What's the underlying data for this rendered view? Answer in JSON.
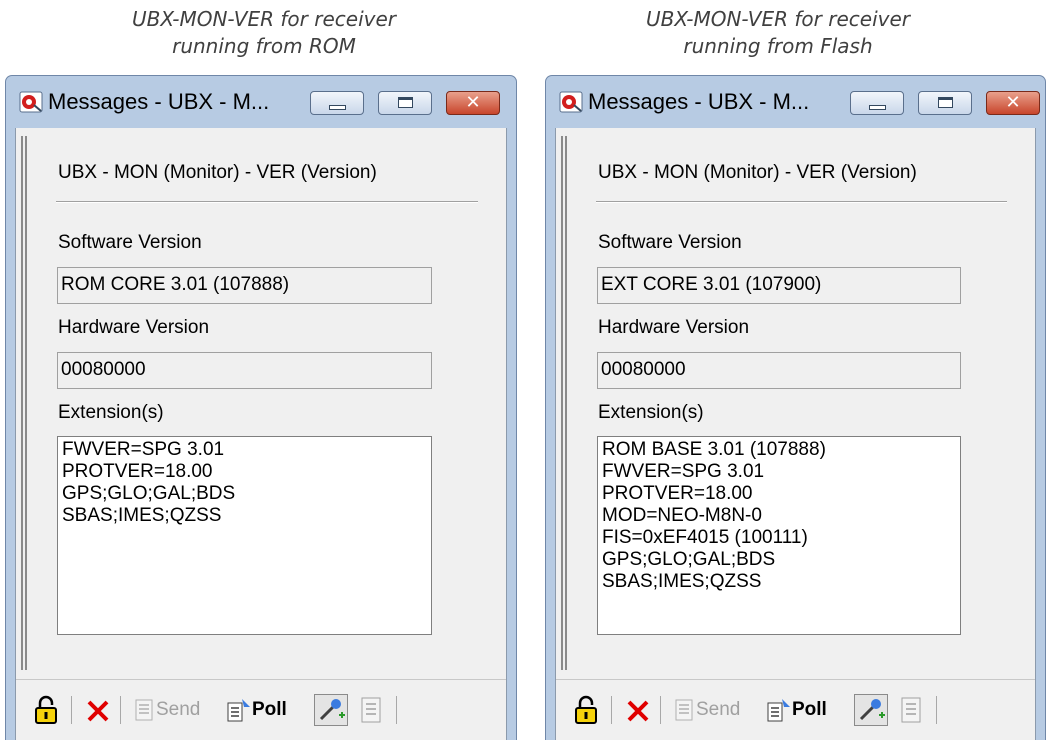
{
  "captions": {
    "left_line1": "UBX-MON-VER for receiver",
    "left_line2": "running from ROM",
    "right_line1": "UBX-MON-VER for receiver",
    "right_line2": "running from Flash"
  },
  "windows": [
    {
      "title": "Messages - UBX - M...",
      "heading": "UBX - MON (Monitor) - VER (Version)",
      "sw_label": "Software Version",
      "sw_value": "ROM CORE 3.01 (107888)",
      "hw_label": "Hardware Version",
      "hw_value": "00080000",
      "ext_label": "Extension(s)",
      "extensions": [
        "FWVER=SPG 3.01",
        "PROTVER=18.00",
        "GPS;GLO;GAL;BDS",
        "SBAS;IMES;QZSS"
      ],
      "toolbar": {
        "send": "Send",
        "poll": "Poll"
      }
    },
    {
      "title": "Messages - UBX - M...",
      "heading": "UBX - MON (Monitor) - VER (Version)",
      "sw_label": "Software Version",
      "sw_value": "EXT CORE 3.01 (107900)",
      "hw_label": "Hardware Version",
      "hw_value": "00080000",
      "ext_label": "Extension(s)",
      "extensions": [
        "ROM BASE 3.01 (107888)",
        "FWVER=SPG 3.01",
        "PROTVER=18.00",
        "MOD=NEO-M8N-0",
        "FIS=0xEF4015 (100111)",
        "GPS;GLO;GAL;BDS",
        "SBAS;IMES;QZSS"
      ],
      "toolbar": {
        "send": "Send",
        "poll": "Poll"
      }
    }
  ],
  "icons": {
    "app": "app-icon",
    "minimize": "minimize-icon",
    "maximize": "maximize-icon",
    "close": "close-icon",
    "lock": "lock-icon",
    "delete": "delete-icon",
    "send": "send-icon",
    "poll": "poll-icon",
    "tool": "tool-icon",
    "doc": "doc-icon"
  },
  "close_glyph": "✕",
  "colors": {
    "titlebar": "#b7cbe3",
    "close": "#c8462c",
    "delete": "#e00000"
  }
}
